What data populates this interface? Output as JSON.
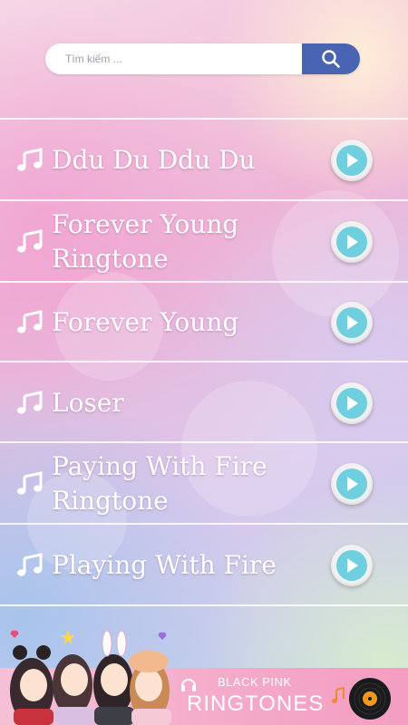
{
  "search": {
    "placeholder": "Tìm kiếm ..."
  },
  "songs": [
    {
      "line1": "Ddu Du Ddu Du",
      "line2": ""
    },
    {
      "line1": "Forever Young",
      "line2": "Ringtone"
    },
    {
      "line1": "Forever Young",
      "line2": ""
    },
    {
      "line1": "Loser",
      "line2": ""
    },
    {
      "line1": "Paying With Fire",
      "line2": "Ringtone"
    },
    {
      "line1": "Playing With Fire",
      "line2": ""
    }
  ],
  "banner": {
    "line1": "BLACK PINK",
    "line2": "RINGTONES"
  },
  "colors": {
    "search_button": "#4a64b4",
    "play_button": "#6fcfdf",
    "banner": "#f4a9c8"
  },
  "icons": {
    "song": "music-note-icon",
    "play": "play-icon",
    "search": "search-icon"
  }
}
